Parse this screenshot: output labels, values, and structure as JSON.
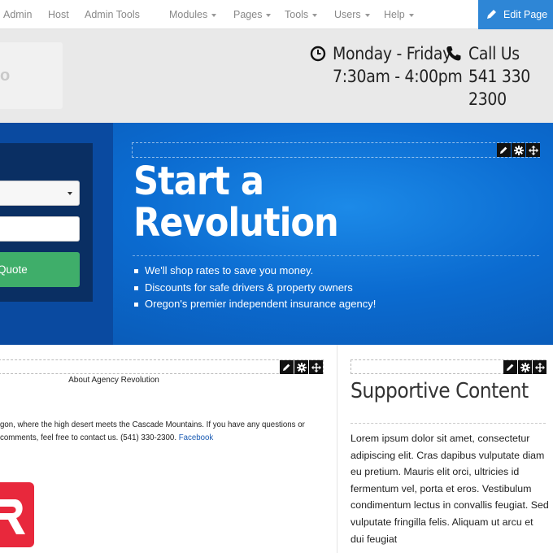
{
  "topbar": {
    "nav": [
      {
        "label": "Admin",
        "caret": false
      },
      {
        "label": "Host",
        "caret": false
      },
      {
        "label": "Admin Tools",
        "caret": false
      },
      {
        "label": "Modules",
        "caret": true
      },
      {
        "label": "Pages",
        "caret": true
      },
      {
        "label": "Tools",
        "caret": true
      },
      {
        "label": "Users",
        "caret": true
      },
      {
        "label": "Help",
        "caret": true
      }
    ],
    "edit_page": "Edit Page"
  },
  "header": {
    "logo_text": "o",
    "hours_line1": "Monday - Friday",
    "hours_line2": "7:30am - 4:00pm",
    "call_line1": "Call Us",
    "call_line2": "541 330 2300"
  },
  "hero": {
    "form": {
      "select_value": "",
      "input_value": "",
      "quote_button": "Quote"
    },
    "title_line1": "Start a",
    "title_line2": "Revolution",
    "bullets": [
      "We'll shop rates to save you money.",
      "Discounts for safe drivers & property owners",
      "Oregon's premier independent insurance agency!"
    ]
  },
  "left_module": {
    "title": "About Agency Revolution",
    "para_line1": "gon, where the high desert meets the Cascade Mountains. If you have any questions or",
    "para_line2": " comments, feel free to contact us. (541) 330-2300.",
    "facebook_link": "Facebook"
  },
  "right_module": {
    "heading": "Supportive Content",
    "body": "Lorem ipsum dolor sit amet, consectetur adipiscing elit. Cras dapibus vulputate diam eu pretium. Mauris elit orci, ultricies id fermentum vel, porta et eros. Vestibulum condimentum lectus in convallis feugiat. Sed vulputate fringilla felis. Aliquam ut arcu et dui feugiat"
  },
  "colors": {
    "edit_button": "#2e86d6",
    "hero_blue": "#0b6bd0",
    "quote_green": "#3fae6a",
    "logo_red": "#e8283c"
  },
  "icons": [
    "edit-pencil-icon",
    "clock-icon",
    "phone-icon",
    "pencil-icon",
    "gear-icon",
    "move-icon",
    "caret-down-icon"
  ]
}
